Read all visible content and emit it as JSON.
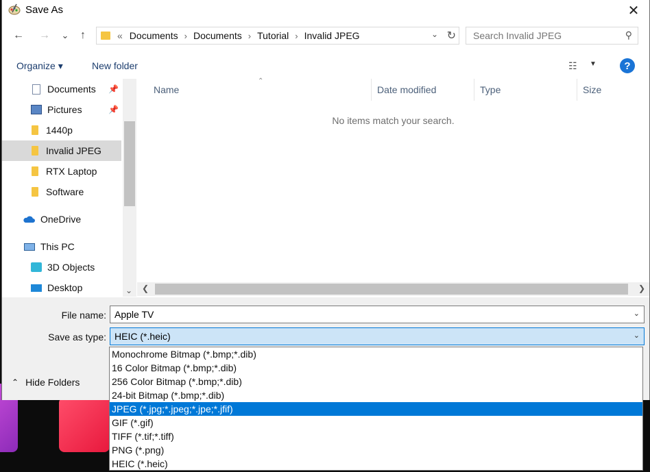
{
  "window": {
    "title": "Save As",
    "close_label": "✕"
  },
  "nav": {
    "back": "←",
    "forward": "→",
    "recent": "⌄",
    "up": "↑",
    "address": {
      "prefix": "«",
      "crumbs": [
        "Documents",
        "Documents",
        "Tutorial",
        "Invalid JPEG"
      ],
      "separator": "›"
    },
    "search_placeholder": "Search Invalid JPEG"
  },
  "toolbar": {
    "organize": "Organize ▾",
    "new_folder": "New folder",
    "help": "?"
  },
  "sidebar": {
    "items": [
      {
        "label": "Documents",
        "icon": "document-icon",
        "pinned": true
      },
      {
        "label": "Pictures",
        "icon": "pictures-icon",
        "pinned": true
      },
      {
        "label": "1440p",
        "icon": "folder-icon"
      },
      {
        "label": "Invalid JPEG",
        "icon": "folder-icon",
        "selected": true
      },
      {
        "label": "RTX Laptop",
        "icon": "folder-icon"
      },
      {
        "label": "Software",
        "icon": "folder-icon"
      },
      {
        "label": "OneDrive",
        "icon": "onedrive-cloud-icon"
      },
      {
        "label": "This PC",
        "icon": "this-pc-icon"
      },
      {
        "label": "3D Objects",
        "icon": "3d-objects-icon"
      },
      {
        "label": "Desktop",
        "icon": "desktop-icon"
      }
    ]
  },
  "file_list": {
    "columns": [
      "Name",
      "Date modified",
      "Type",
      "Size"
    ],
    "empty_message": "No items match your search."
  },
  "form": {
    "file_name_label": "File name:",
    "file_name_value": "Apple TV",
    "save_as_type_label": "Save as type:",
    "save_as_type_value": "HEIC (*.heic)",
    "hide_folders": "Hide Folders"
  },
  "type_options": [
    "Monochrome Bitmap (*.bmp;*.dib)",
    "16 Color Bitmap (*.bmp;*.dib)",
    "256 Color Bitmap (*.bmp;*.dib)",
    "24-bit Bitmap (*.bmp;*.dib)",
    "JPEG (*.jpg;*.jpeg;*.jpe;*.jfif)",
    "GIF (*.gif)",
    "TIFF (*.tif;*.tiff)",
    "PNG (*.png)",
    "HEIC (*.heic)"
  ],
  "highlighted_option": "JPEG (*.jpg;*.jpeg;*.jpe;*.jfif)",
  "colors": {
    "accent": "#0078d7",
    "help": "#1a74d6",
    "folder": "#f5c542"
  }
}
